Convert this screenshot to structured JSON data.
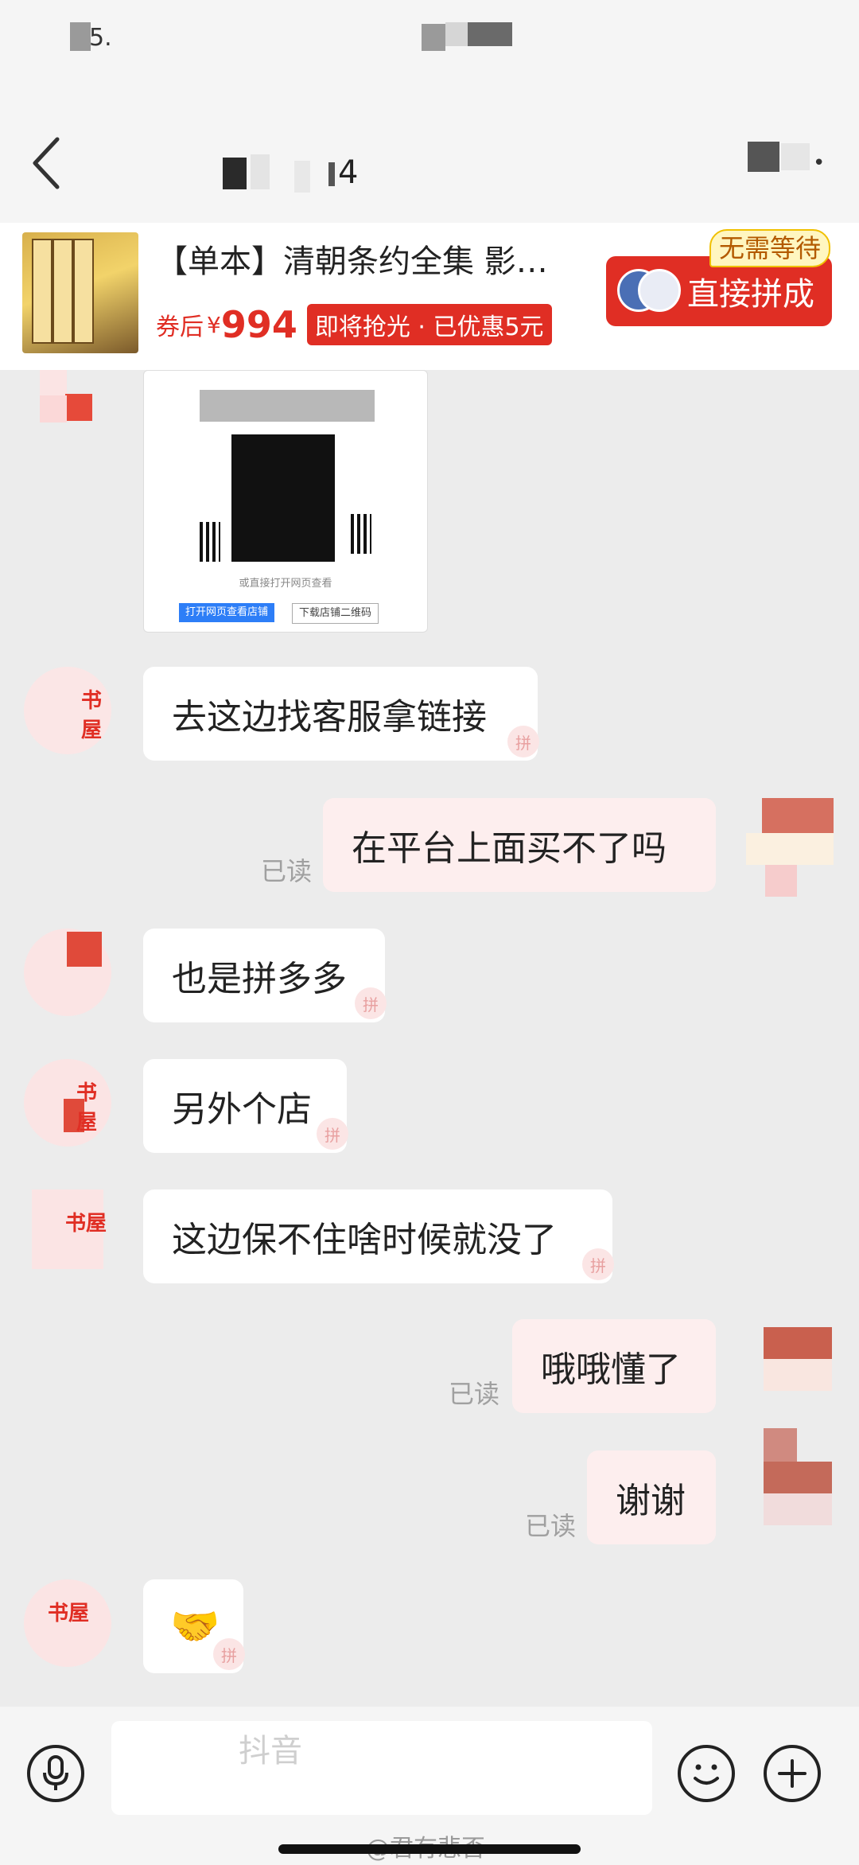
{
  "header": {
    "title_fragment": "4",
    "status_fragment": "5."
  },
  "product": {
    "title": "【单本】清朝条约全集 影…",
    "coupon_label": "券后",
    "currency": "¥",
    "price": "994",
    "promo": "即将抢光 · 已优惠5元",
    "buy_label": "直接拼成",
    "wait_tag": "无需等待"
  },
  "qr_card": {
    "caption": "或直接打开网页查看",
    "open_web_label": "打开网页查看店铺",
    "download_qr_label": "下载店铺二维码"
  },
  "shop_name_fragment": "书屋",
  "messages": [
    {
      "side": "left",
      "text": "去这边找客服拿链接"
    },
    {
      "side": "right",
      "text": "在平台上面买不了吗",
      "status": "已读"
    },
    {
      "side": "left",
      "text": "也是拼多多"
    },
    {
      "side": "left",
      "text": "另外个店"
    },
    {
      "side": "left",
      "text": "这边保不住啥时候就没了"
    },
    {
      "side": "right",
      "text": "哦哦懂了",
      "status": "已读"
    },
    {
      "side": "right",
      "text": "谢谢",
      "status": "已读"
    },
    {
      "side": "left",
      "text": "🤝"
    }
  ],
  "pin_mark": "拼",
  "input": {
    "placeholder": ""
  },
  "watermark": {
    "platform": "抖音",
    "user": "@君有悲否"
  },
  "colors": {
    "accent": "#e02e24",
    "bubble_self": "#fdeeee",
    "bubble_other": "#ffffff",
    "background": "#ececec"
  }
}
